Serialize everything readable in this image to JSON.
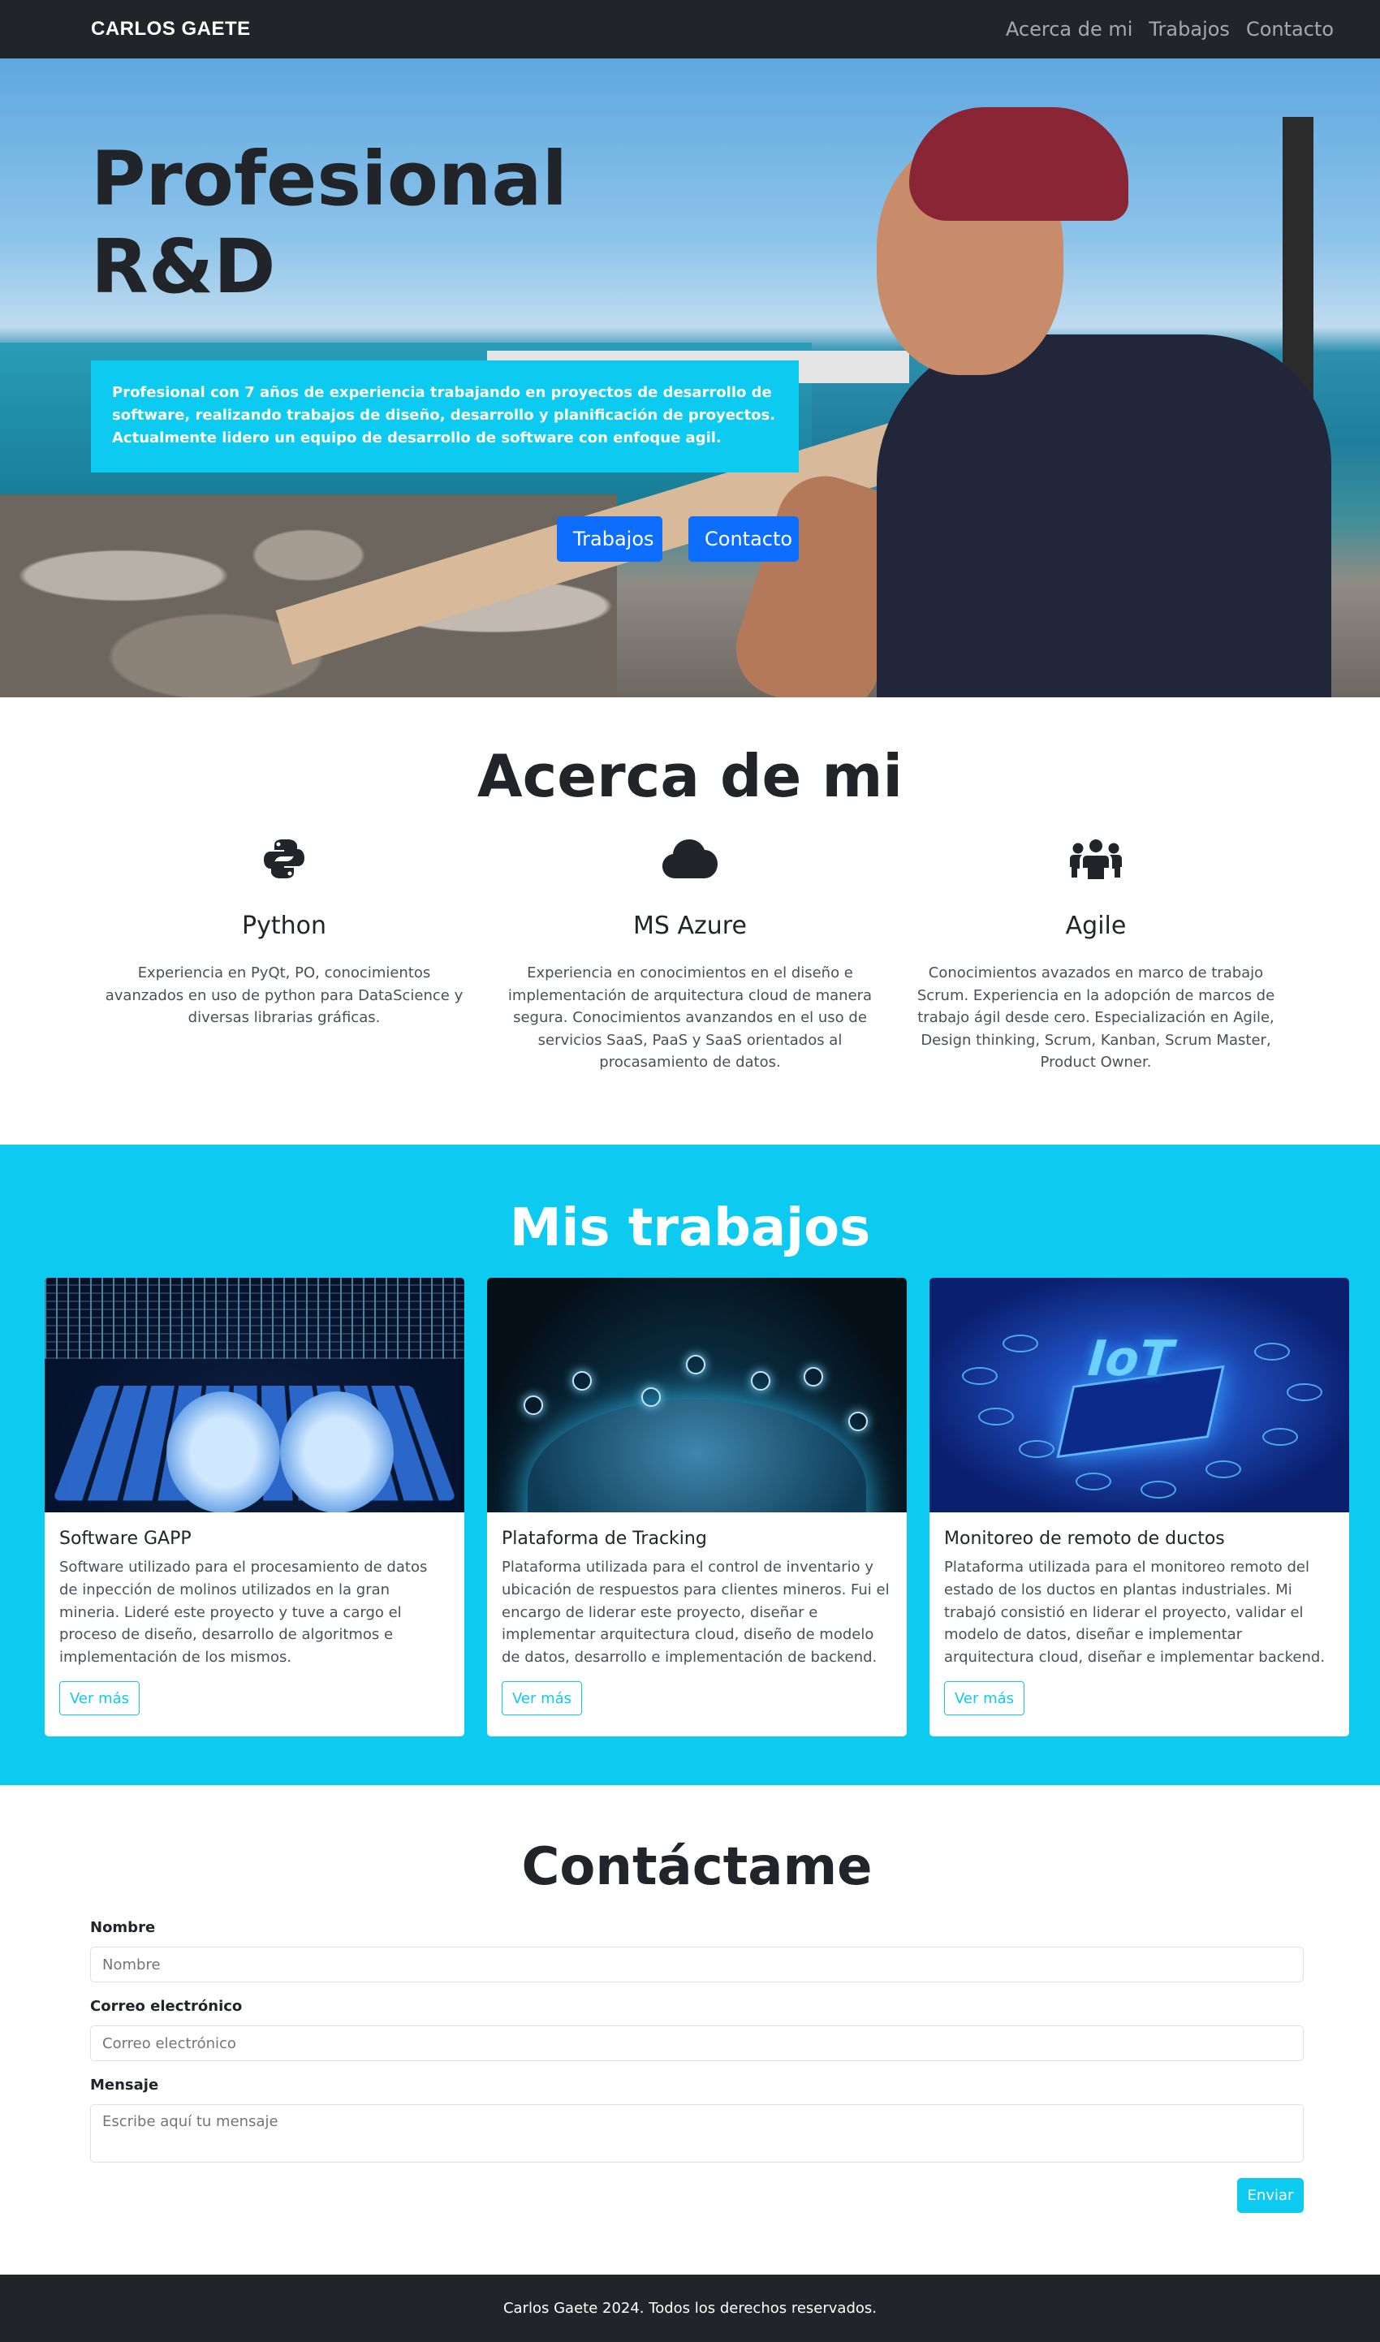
{
  "navbar": {
    "brand": "CARLOS GAETE",
    "links": [
      "Acerca de mi",
      "Trabajos",
      "Contacto"
    ]
  },
  "hero": {
    "title_line1": "Profesional",
    "title_line2": "R&D",
    "description": "Profesional con 7 años de experiencia trabajando en proyectos de desarrollo de software, realizando trabajos de diseño, desarrollo y planificación de proyectos. Actualmente lidero un equipo de desarrollo de software con enfoque agil.",
    "buttons": [
      "Trabajos",
      "Contacto"
    ]
  },
  "about": {
    "title": "Acerca de mi",
    "skills": [
      {
        "icon": "python-icon",
        "title": "Python",
        "text": "Experiencia en PyQt, PO, conocimientos avanzados en uso de python para DataScience y diversas librarias gráficas."
      },
      {
        "icon": "cloud-icon",
        "title": "MS Azure",
        "text": "Experiencia en conocimientos en el diseño e implementación de arquitectura cloud de manera segura. Conocimientos avanzandos en el uso de servicios SaaS, PaaS y SaaS orientados al procasamiento de datos."
      },
      {
        "icon": "team-icon",
        "title": "Agile",
        "text": "Conocimientos avazados en marco de trabajo Scrum. Experiencia en la adopción de marcos de trabajo ágil desde cero. Especialización en Agile, Design thinking, Scrum, Kanban, Scrum Master, Product Owner."
      }
    ]
  },
  "works": {
    "title": "Mis trabajos",
    "cards": [
      {
        "title": "Software GAPP",
        "text": "Software utilizado para el procesamiento de datos de inpección de molinos utilizados en la gran mineria. Lideré este proyecto y tuve a cargo el proceso de diseño, desarrollo de algoritmos e implementación de los mismos.",
        "button": "Ver más"
      },
      {
        "title": "Plataforma de Tracking",
        "text": "Plataforma utilizada para el control de inventario y ubicación de respuestos para clientes mineros. Fui el encargo de liderar este proyecto, diseñar e implementar arquitectura cloud, diseño de modelo de datos, desarrollo e implementación de backend.",
        "button": "Ver más"
      },
      {
        "title": "Monitoreo de remoto de ductos",
        "text": "Plataforma utilizada para el monitoreo remoto del estado de los ductos en plantas industriales. Mi trabajó consistió en liderar el proyecto, validar el modelo de datos, diseñar e implementar arquitectura cloud, diseñar e implementar backend.",
        "button": "Ver más"
      }
    ]
  },
  "contact": {
    "title": "Contáctame",
    "name_label": "Nombre",
    "name_placeholder": "Nombre",
    "email_label": "Correo electrónico",
    "email_placeholder": "Correo electrónico",
    "message_label": "Mensaje",
    "message_placeholder": "Escribe aquí tu mensaje",
    "submit": "Enviar"
  },
  "footer": {
    "text": "Carlos Gaete 2024. Todos los derechos reservados."
  },
  "colors": {
    "dark": "#212529",
    "info": "#0dcaf0",
    "primary": "#0d6efd"
  }
}
